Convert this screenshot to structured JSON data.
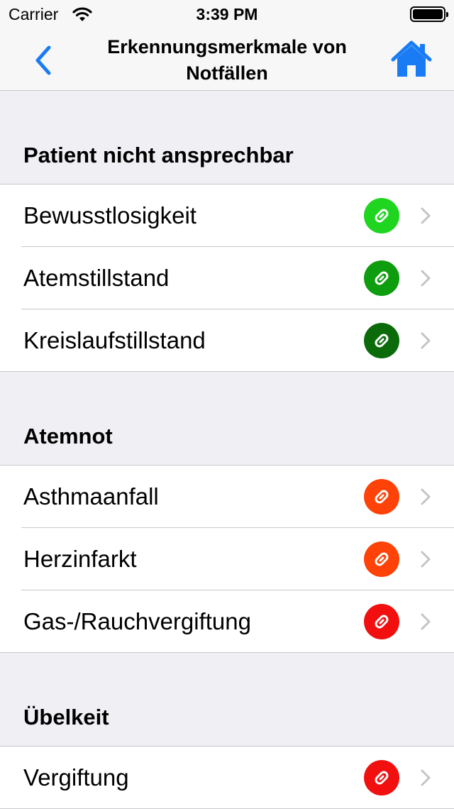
{
  "status_bar": {
    "carrier": "Carrier",
    "time": "3:39 PM"
  },
  "nav": {
    "title": "Erkennungsmerkmale von Notfällen",
    "back_icon": "chevron-left-icon",
    "home_icon": "house-icon",
    "accent_color": "#1a7cf5"
  },
  "sections": [
    {
      "title": "Patient nicht ansprechbar",
      "items": [
        {
          "label": "Bewusstlosigkeit",
          "badge_color": "#1fd51f"
        },
        {
          "label": "Atemstillstand",
          "badge_color": "#0e9d0e"
        },
        {
          "label": "Kreislaufstillstand",
          "badge_color": "#0b6b0b"
        }
      ]
    },
    {
      "title": "Atemnot",
      "items": [
        {
          "label": "Asthmaanfall",
          "badge_color": "#ff4208"
        },
        {
          "label": "Herzinfarkt",
          "badge_color": "#ff4208"
        },
        {
          "label": "Gas-/Rauchvergiftung",
          "badge_color": "#f20f0f"
        }
      ]
    },
    {
      "title": "Übelkeit",
      "items": [
        {
          "label": "Vergiftung",
          "badge_color": "#f20f0f"
        }
      ]
    }
  ]
}
